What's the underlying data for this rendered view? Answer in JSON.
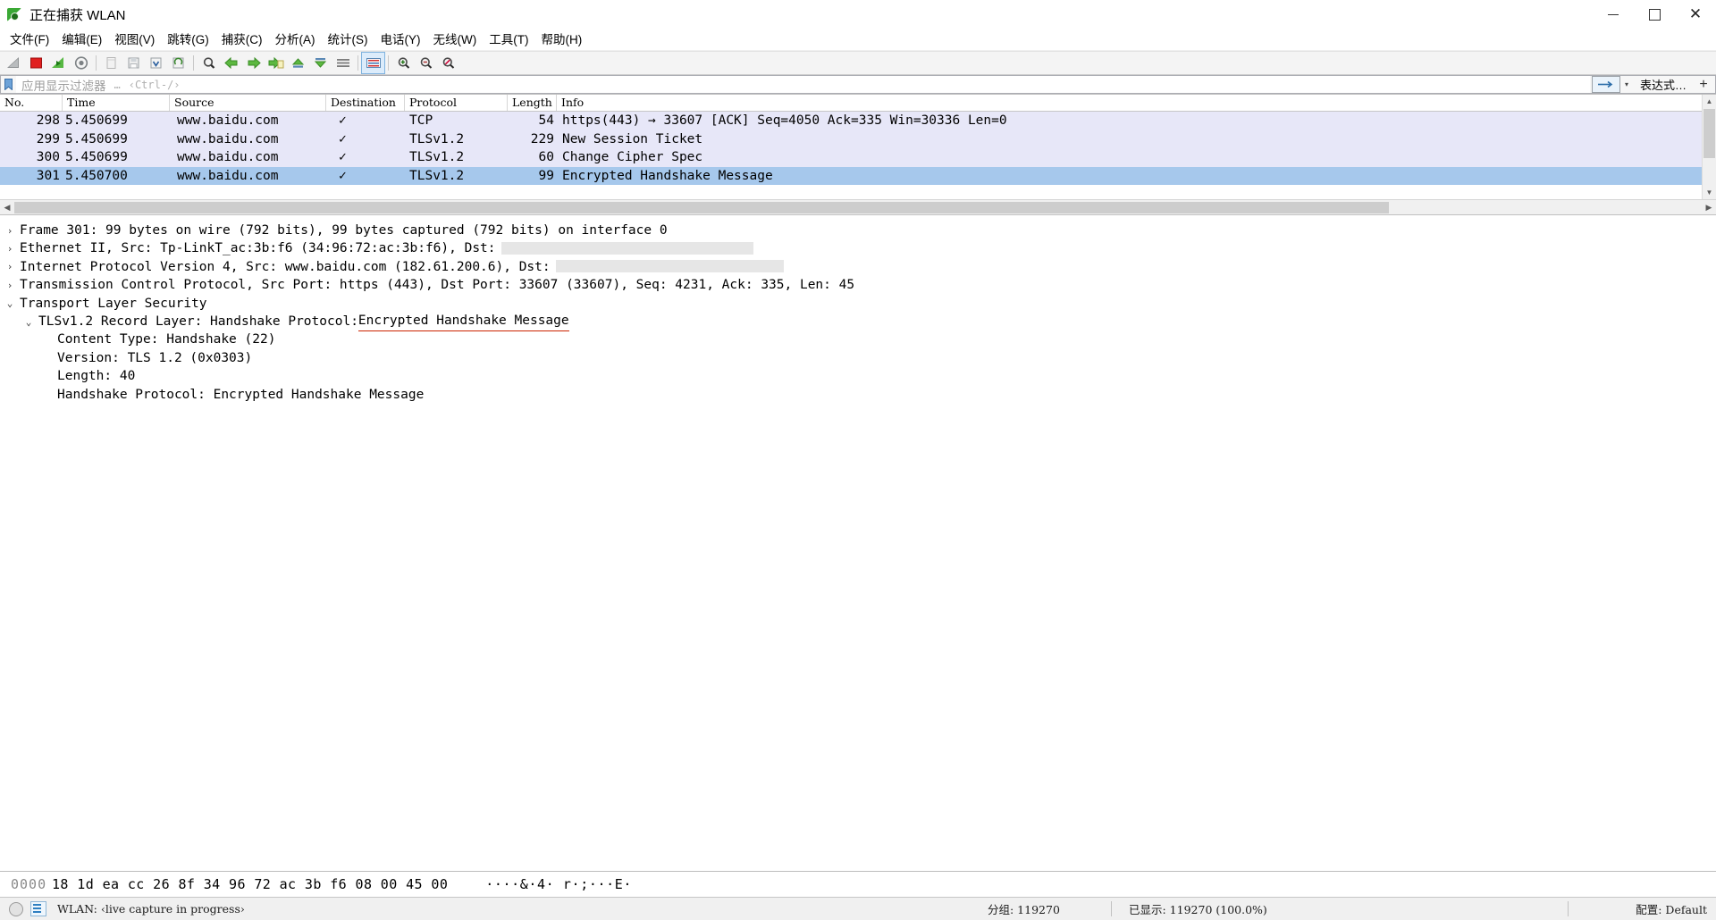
{
  "window": {
    "title": "正在捕获 WLAN",
    "icon": "wireshark-shark-fin-icon",
    "minimize": "—",
    "maximize": "□",
    "close": "✕"
  },
  "menu": {
    "items": [
      {
        "label": "文件(F)",
        "name": "menu-file"
      },
      {
        "label": "编辑(E)",
        "name": "menu-edit"
      },
      {
        "label": "视图(V)",
        "name": "menu-view"
      },
      {
        "label": "跳转(G)",
        "name": "menu-go"
      },
      {
        "label": "捕获(C)",
        "name": "menu-capture"
      },
      {
        "label": "分析(A)",
        "name": "menu-analyze"
      },
      {
        "label": "统计(S)",
        "name": "menu-statistics"
      },
      {
        "label": "电话(Y)",
        "name": "menu-telephony"
      },
      {
        "label": "无线(W)",
        "name": "menu-wireless"
      },
      {
        "label": "工具(T)",
        "name": "menu-tools"
      },
      {
        "label": "帮助(H)",
        "name": "menu-help"
      }
    ]
  },
  "toolbar": {
    "buttons": [
      {
        "name": "start-capture-icon",
        "title": "开始捕获"
      },
      {
        "name": "stop-capture-icon",
        "title": "停止捕获"
      },
      {
        "name": "restart-capture-icon",
        "title": "重新开始捕获"
      },
      {
        "name": "capture-options-icon",
        "title": "捕获选项"
      },
      {
        "name": "open-file-icon",
        "title": "打开"
      },
      {
        "name": "save-file-icon",
        "title": "保存"
      },
      {
        "name": "close-file-icon",
        "title": "关闭"
      },
      {
        "name": "reload-file-icon",
        "title": "重新加载"
      },
      {
        "name": "find-packet-icon",
        "title": "查找分组"
      },
      {
        "name": "go-back-icon",
        "title": "后退"
      },
      {
        "name": "go-forward-icon",
        "title": "前进"
      },
      {
        "name": "go-to-packet-icon",
        "title": "转到分组"
      },
      {
        "name": "go-first-packet-icon",
        "title": "转到第一个分组"
      },
      {
        "name": "go-last-packet-icon",
        "title": "转到最后一个分组"
      },
      {
        "name": "auto-scroll-icon",
        "title": "实时捕获时自动滚动"
      },
      {
        "name": "colorize-icon",
        "title": "着色分组列表"
      },
      {
        "name": "zoom-in-icon",
        "title": "放大"
      },
      {
        "name": "zoom-out-icon",
        "title": "缩小"
      },
      {
        "name": "zoom-reset-icon",
        "title": "恢复正常大小"
      }
    ]
  },
  "filter": {
    "bookmark_icon": "bookmark-icon",
    "placeholder": "应用显示过滤器",
    "ellipsis": "…",
    "shortcut_hint": "‹Ctrl-/›",
    "value": "",
    "expression_label": "表达式…",
    "add_label": "+",
    "caret": "▾"
  },
  "packet_list": {
    "columns": [
      "No.",
      "Time",
      "Source",
      "Destination",
      "Protocol",
      "Length",
      "Info"
    ],
    "rows": [
      {
        "no": "298",
        "time": "5.450699",
        "source": "www.baidu.com",
        "destination": "✓",
        "protocol": "TCP",
        "length": "54",
        "info": "https(443) → 33607 [ACK] Seq=4050 Ack=335 Win=30336 Len=0",
        "state": "alt"
      },
      {
        "no": "299",
        "time": "5.450699",
        "source": "www.baidu.com",
        "destination": "✓",
        "protocol": "TLSv1.2",
        "length": "229",
        "info": "New Session Ticket",
        "state": "alt"
      },
      {
        "no": "300",
        "time": "5.450699",
        "source": "www.baidu.com",
        "destination": "✓",
        "protocol": "TLSv1.2",
        "length": "60",
        "info": "Change Cipher Spec",
        "state": "alt"
      },
      {
        "no": "301",
        "time": "5.450700",
        "source": "www.baidu.com",
        "destination": "✓",
        "protocol": "TLSv1.2",
        "length": "99",
        "info": "Encrypted Handshake Message",
        "state": "sel"
      }
    ]
  },
  "detail_tree": [
    {
      "arrow": "›",
      "expanded": false,
      "indent": 0,
      "text": "Frame 301: 99 bytes on wire (792 bits), 99 bytes captured (792 bits) on interface 0",
      "name": "detail-frame"
    },
    {
      "arrow": "›",
      "expanded": false,
      "indent": 0,
      "text": "Ethernet II, Src: Tp-LinkT_ac:3b:f6 (34:96:72:ac:3b:f6), Dst:",
      "redacted": 282,
      "name": "detail-ethernet"
    },
    {
      "arrow": "›",
      "expanded": false,
      "indent": 0,
      "text": "Internet Protocol Version 4, Src: www.baidu.com (182.61.200.6), Dst:",
      "redacted": 255,
      "name": "detail-ipv4"
    },
    {
      "arrow": "›",
      "expanded": false,
      "indent": 0,
      "text": "Transmission Control Protocol, Src Port: https (443), Dst Port: 33607 (33607), Seq: 4231, Ack: 335, Len: 45",
      "name": "detail-tcp"
    },
    {
      "arrow": "⌄",
      "expanded": true,
      "indent": 0,
      "text": "Transport Layer Security",
      "name": "detail-tls"
    },
    {
      "arrow": "⌄",
      "expanded": true,
      "indent": 1,
      "text": "TLSv1.2 Record Layer: Handshake Protocol: ",
      "highlight": "Encrypted Handshake Message",
      "name": "detail-tls-record-layer"
    },
    {
      "arrow": "",
      "expanded": false,
      "indent": 2,
      "text": "Content Type: Handshake (22)",
      "name": "detail-content-type"
    },
    {
      "arrow": "",
      "expanded": false,
      "indent": 2,
      "text": "Version: TLS 1.2 (0x0303)",
      "name": "detail-version"
    },
    {
      "arrow": "",
      "expanded": false,
      "indent": 2,
      "text": "Length: 40",
      "name": "detail-length"
    },
    {
      "arrow": "",
      "expanded": false,
      "indent": 2,
      "text": "Handshake Protocol: Encrypted Handshake Message",
      "name": "detail-handshake-protocol"
    }
  ],
  "bytes_pane": {
    "offset": "0000",
    "hex": "18 1d ea cc 26 8f 34 96  72 ac 3b f6 08 00 45 00",
    "ascii": "····&·4· r·;···E·"
  },
  "status_bar": {
    "interface_text": "WLAN: ‹live capture in progress›",
    "packets_label": "分组: 119270",
    "displayed_label": "已显示: 119270 (100.0%)",
    "profile_label": "配置: Default",
    "icon_expert": "expert-info-icon",
    "icon_capture_file": "capture-file-properties-icon"
  },
  "colors": {
    "selected_row": "#a6c8ec",
    "alt_row": "#e7e7f8",
    "accent_green": "#3aa935",
    "underline_red": "#cc2200"
  }
}
